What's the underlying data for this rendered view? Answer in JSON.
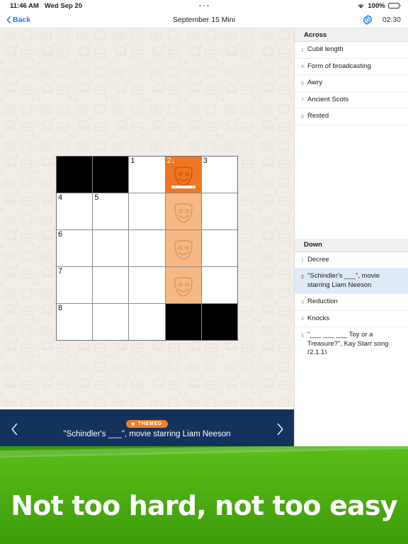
{
  "status_bar": {
    "time": "11:46 AM",
    "date": "Wed Sep 20",
    "wifi_icon": "wifi-icon",
    "battery_percent": "100%",
    "menu_icon": "more-dots-icon"
  },
  "nav_bar": {
    "back_label": "Back",
    "back_icon": "chevron-left-icon",
    "title": "September 15 Mini",
    "settings_icon": "gear-icon",
    "timer": "02:30"
  },
  "grid": {
    "rows": 5,
    "cols": 5,
    "cells": [
      [
        {
          "type": "block"
        },
        {
          "type": "block"
        },
        {
          "type": "open",
          "number": "1"
        },
        {
          "type": "selected",
          "number": "2",
          "arrow": "↓",
          "icon": "theater-mask-icon",
          "cursor": true
        },
        {
          "type": "open",
          "number": "3"
        }
      ],
      [
        {
          "type": "open",
          "number": "4"
        },
        {
          "type": "open",
          "number": "5"
        },
        {
          "type": "open",
          "number": ""
        },
        {
          "type": "highlighted",
          "number": "",
          "icon": "theater-mask-icon"
        },
        {
          "type": "open",
          "number": ""
        }
      ],
      [
        {
          "type": "open",
          "number": "6"
        },
        {
          "type": "open",
          "number": ""
        },
        {
          "type": "open",
          "number": ""
        },
        {
          "type": "highlighted",
          "number": "",
          "icon": "theater-mask-icon"
        },
        {
          "type": "open",
          "number": ""
        }
      ],
      [
        {
          "type": "open",
          "number": "7"
        },
        {
          "type": "open",
          "number": ""
        },
        {
          "type": "open",
          "number": ""
        },
        {
          "type": "highlighted",
          "number": "",
          "icon": "theater-mask-icon"
        },
        {
          "type": "open",
          "number": ""
        }
      ],
      [
        {
          "type": "open",
          "number": "8"
        },
        {
          "type": "open",
          "number": ""
        },
        {
          "type": "open",
          "number": ""
        },
        {
          "type": "block"
        },
        {
          "type": "block"
        }
      ]
    ]
  },
  "clue_bar": {
    "prev_icon": "chevron-left-icon",
    "next_icon": "chevron-right-icon",
    "badge_label": "THEMED",
    "badge_icon": "star-icon",
    "clue_text": "\"Schindler's ___\", movie starring Liam Neeson"
  },
  "clue_panel": {
    "across_header": "Across",
    "across": [
      {
        "number": "1",
        "text": "Cubit length",
        "active": false
      },
      {
        "number": "4",
        "text": "Form of broadcasting",
        "active": false
      },
      {
        "number": "6",
        "text": "Awry",
        "active": false
      },
      {
        "number": "7",
        "text": "Ancient Scots",
        "active": false
      },
      {
        "number": "8",
        "text": "Rested",
        "active": false
      }
    ],
    "down_header": "Down",
    "down": [
      {
        "number": "1",
        "text": "Decree",
        "active": false
      },
      {
        "number": "2",
        "text": "\"Schindler's ___\", movie starring Liam Neeson",
        "active": true
      },
      {
        "number": "3",
        "text": "Reduction",
        "active": false
      },
      {
        "number": "4",
        "text": "Knocks",
        "active": false
      },
      {
        "number": "5",
        "text": "\"___ ___ ___ Toy or a Treasure?\", Kay Starr song (2,1,1)",
        "active": false
      }
    ]
  },
  "ad_banner": {
    "headline": "Not too hard, not too easy"
  },
  "colors": {
    "accent_orange": "#ef7622",
    "highlight_orange": "#f6b783",
    "link_blue": "#1f7aeb",
    "clue_bar_navy": "#14325e",
    "active_clue_blue": "#dfeaf9",
    "ad_green_top": "#57b618",
    "ad_green_bottom": "#3f9f0a",
    "puzzle_bg": "#f2ece6"
  }
}
